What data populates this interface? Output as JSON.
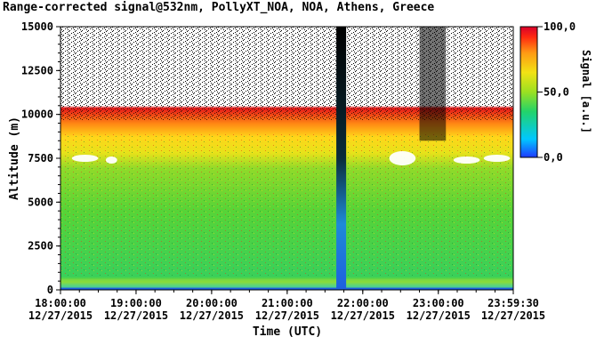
{
  "chart_data": {
    "type": "heatmap",
    "title": "Range-corrected signal@532nm, PollyXT_NOA, NOA, Athens, Greece",
    "xlabel": "Time (UTC)",
    "ylabel": "Altitude (m)",
    "colorbar_label": "Signal [a.u.]",
    "yticks": [
      "0",
      "2500",
      "5000",
      "7500",
      "10000",
      "12500",
      "15000"
    ],
    "ylim": [
      0,
      15000
    ],
    "xticks": [
      {
        "time": "18:00:00",
        "date": "12/27/2015"
      },
      {
        "time": "19:00:00",
        "date": "12/27/2015"
      },
      {
        "time": "20:00:00",
        "date": "12/27/2015"
      },
      {
        "time": "21:00:00",
        "date": "12/27/2015"
      },
      {
        "time": "22:00:00",
        "date": "12/27/2015"
      },
      {
        "time": "23:00:00",
        "date": "12/27/2015"
      },
      {
        "time": "23:59:30",
        "date": "12/27/2015"
      }
    ],
    "x_hours": [
      18,
      19,
      20,
      21,
      22,
      23,
      23.9917
    ],
    "xlim_hours": [
      18,
      23.9917
    ],
    "colorbar_ticks": [
      "0,0",
      "50,0",
      "100,0"
    ],
    "colorbar_range": [
      0,
      100
    ],
    "colorscale": [
      "#1e3aff",
      "#00c8ff",
      "#22d36a",
      "#9be021",
      "#f2e214",
      "#ff9a14",
      "#ff2a10",
      "#d9002a"
    ],
    "features": {
      "boundary_layer_top_m": 600,
      "cloud_layer_m": [
        7200,
        7800
      ],
      "noise_onset_m": 10500,
      "beam_blocked_interval_hours": [
        21.65,
        21.78
      ],
      "dark_streak_interval_hours": [
        22.75,
        23.1
      ]
    }
  }
}
